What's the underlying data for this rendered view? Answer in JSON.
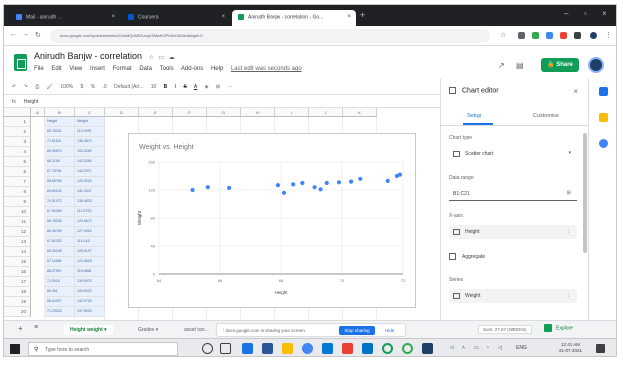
{
  "browser": {
    "tabs": [
      {
        "label": "Mail - anirudh ... ",
        "active": false
      },
      {
        "label": "Coursera",
        "active": false
      },
      {
        "label": "Anirudh Banjw - correlation - Go...",
        "active": true
      }
    ],
    "url": "docs.google.com/spreadsheets/d/1vkMQrWE2uxqZ4MwKGPhtDs3k0/edit#gid=0"
  },
  "sheets": {
    "doc_title": "Anirudh Banjw - correlation",
    "menu": [
      "File",
      "Edit",
      "View",
      "Insert",
      "Format",
      "Data",
      "Tools",
      "Add-ons",
      "Help"
    ],
    "last_edit": "Last edit was seconds ago",
    "share_label": "Share",
    "toolbar_zoom": "100%",
    "toolbar_font": "Default (Ari...",
    "toolbar_size": "10",
    "cell_ref": "A1",
    "formula_value": "Height"
  },
  "grid": {
    "columns": [
      "A",
      "B",
      "C",
      "D",
      "E",
      "F",
      "G",
      "H",
      "I",
      "J",
      "K"
    ],
    "rows": [
      "1",
      "2",
      "3",
      "4",
      "5",
      "6",
      "7",
      "8",
      "9",
      "10",
      "11",
      "12",
      "13",
      "14",
      "15",
      "16",
      "17",
      "18",
      "19",
      "20"
    ],
    "col_b": [
      "Height",
      "65.78331",
      "71.51521",
      "69.39874",
      "68.2166",
      "67.78781",
      "68.69784",
      "69.80204",
      "70.01472",
      "67.90265",
      "66.78236",
      "66.48769",
      "67.62333",
      "68.30248",
      "67.11656",
      "68.27967",
      "71.0916",
      "66.461",
      "68.64927",
      "71.23033"
    ],
    "col_c": [
      "Weight",
      "112.9925",
      "136.4873",
      "153.0269",
      "142.3354",
      "144.2971",
      "123.3024",
      "141.4947",
      "136.4623",
      "112.3723",
      "120.6672",
      "127.4516",
      "114.143",
      "125.6107",
      "122.4618",
      "116.0866",
      "139.9975",
      "129.5023",
      "142.9733",
      "137.9025"
    ]
  },
  "chart_data": {
    "type": "scatter",
    "title": "Weight vs. Height",
    "xlabel": "Height",
    "ylabel": "Weight",
    "xlim": [
      64,
      72
    ],
    "ylim": [
      0,
      160
    ],
    "x_ticks": [
      "64",
      "66",
      "68",
      "70",
      "72"
    ],
    "y_ticks": [
      "0",
      "40",
      "80",
      "120",
      "160"
    ],
    "grid": true,
    "legend": "none",
    "point_color": "#4285f4",
    "points": [
      [
        65.1,
        120
      ],
      [
        65.6,
        124
      ],
      [
        66.3,
        123
      ],
      [
        67.9,
        127
      ],
      [
        68.1,
        116
      ],
      [
        68.4,
        128
      ],
      [
        68.7,
        130
      ],
      [
        69.1,
        124
      ],
      [
        69.3,
        121
      ],
      [
        69.5,
        130
      ],
      [
        69.9,
        131
      ],
      [
        70.3,
        132
      ],
      [
        70.6,
        136
      ],
      [
        71.5,
        133
      ],
      [
        71.8,
        140
      ],
      [
        71.9,
        142
      ],
      [
        72.6,
        136
      ],
      [
        73.4,
        152
      ],
      [
        73.7,
        140
      ]
    ]
  },
  "sheet_tabs": [
    "Height weight",
    "Grades",
    "asset ran..."
  ],
  "share_toast": {
    "text": "docs.google.com is sharing your screen.",
    "stop_label": "Stop sharing",
    "hide_label": "Hide"
  },
  "sum_box": "Sum: 27.67 (WEEKS)",
  "explore_label": "Explore",
  "editor": {
    "title": "Chart editor",
    "tab_setup": "Setup",
    "tab_customise": "Customise",
    "chart_type_label": "Chart type",
    "chart_type_value": "Scatter chart",
    "data_range_label": "Data range",
    "data_range_value": "B1:C21",
    "x_axis_label": "X-axis",
    "x_axis_value": "Height",
    "aggregate_label": "Aggregate",
    "series_label": "Series",
    "series_value": "Weight"
  },
  "taskbar": {
    "search_placeholder": "Type here to search",
    "time": "12:41 AM",
    "date": "21-07-2021",
    "lang": "ENG"
  },
  "colors": {
    "sheets_green": "#0f9d58",
    "accent_blue": "#1a73e8",
    "chrome_dark": "#202124"
  }
}
